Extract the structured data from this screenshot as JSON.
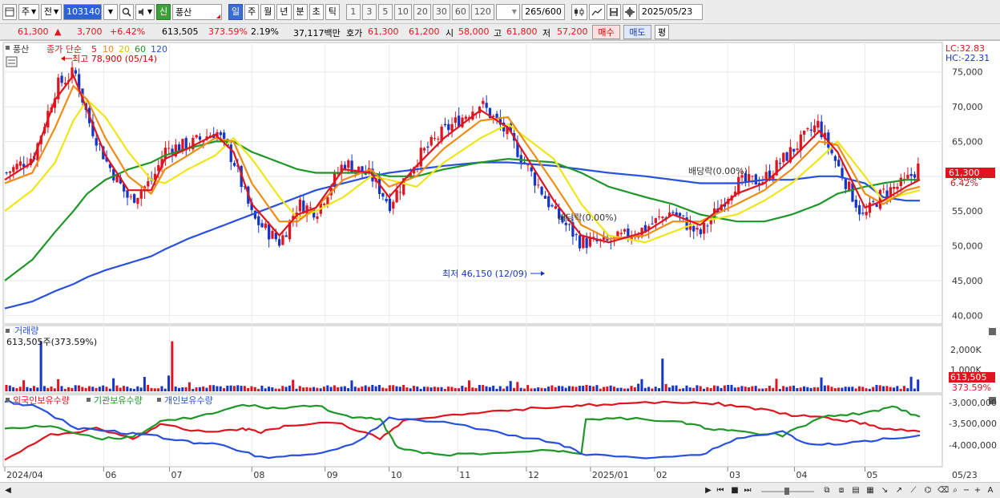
{
  "toolbar": {
    "mode": "주",
    "mode2": "전",
    "code": "103140",
    "stock_name": "풍산",
    "credit_badge": "신",
    "periods": [
      "일",
      "주",
      "월",
      "년",
      "분",
      "초",
      "틱"
    ],
    "active_period": "일",
    "intervals": [
      "1",
      "3",
      "5",
      "10",
      "20",
      "30",
      "60",
      "120"
    ],
    "count": "265",
    "count_total": "/600",
    "date": "2025/05/23"
  },
  "quote": {
    "price": "61,300",
    "arrow": "▲",
    "change": "3,700",
    "change_pct": "+6.42%",
    "volume": "613,505",
    "volume_ratio": "373.59%",
    "turnover_rate": "2.19%",
    "amount": "37,117백만",
    "ask_label": "호가",
    "ask1": "61,300",
    "ask2": "61,200",
    "open_label": "시",
    "open": "58,000",
    "high_label": "고",
    "high": "61,800",
    "low_label": "저",
    "low": "57,200",
    "buy_label": "매수",
    "sell_label": "매도",
    "avg_label": "평"
  },
  "legend": {
    "stock": "풍산",
    "ma_title": "종가 단순",
    "ma_periods": [
      "5",
      "10",
      "20",
      "60",
      "120"
    ],
    "ma_colors": [
      "#e0141e",
      "#f08c14",
      "#f0e614",
      "#1e9628",
      "#2850dc"
    ],
    "high_note": "최고 78,900 (05/14)",
    "low_note": "최저 46,150 (12/09)",
    "dividend1": "배당락(0.00%)",
    "dividend2": "배당락(0.00%)",
    "lc": "LC:32.83",
    "hc": "HC:-22.31"
  },
  "price_axis": {
    "labels": [
      "75,000",
      "70,000",
      "65,000",
      "60,000",
      "55,000",
      "50,000",
      "45,000",
      "40,000"
    ],
    "current": "61,300",
    "current_pct": "6.42%"
  },
  "volume_panel": {
    "title": "거래량",
    "value": "613,505주(373.59%)",
    "axis": [
      "2,000K",
      "1,000K"
    ],
    "current": "613,505",
    "current_pct": "373.59%"
  },
  "holdings_panel": {
    "series": [
      "외국인보유수량",
      "기관보유수량",
      "개인보유수량"
    ],
    "colors": [
      "#e0141e",
      "#1e9628",
      "#2850dc"
    ],
    "axis": [
      "-3,000,000",
      "-3,500,000",
      "-4,000,000"
    ]
  },
  "x_axis": {
    "labels": [
      "2024/04",
      "06",
      "07",
      "08",
      "09",
      "10",
      "11",
      "12",
      "2025/01",
      "02",
      "03",
      "04",
      "05"
    ],
    "right_label": "05/23"
  },
  "chart_data": {
    "type": "line",
    "price_ylim": [
      39000,
      79000
    ],
    "price_x": [
      0,
      0.03,
      0.055,
      0.075,
      0.09,
      0.11,
      0.135,
      0.16,
      0.175,
      0.2,
      0.23,
      0.25,
      0.27,
      0.3,
      0.32,
      0.34,
      0.37,
      0.4,
      0.42,
      0.45,
      0.48,
      0.52,
      0.55,
      0.6,
      0.63,
      0.66,
      0.7,
      0.73,
      0.76,
      0.8,
      0.83,
      0.86,
      0.89,
      0.91,
      0.94,
      0.96,
      0.985,
      1.0
    ],
    "close": [
      60500,
      63000,
      73000,
      75000,
      68000,
      62000,
      56500,
      59500,
      64000,
      64500,
      66500,
      62000,
      54000,
      50500,
      56000,
      55000,
      62000,
      60000,
      56000,
      62500,
      66500,
      70500,
      66000,
      55000,
      50500,
      50500,
      52500,
      55000,
      51500,
      59000,
      59500,
      63500,
      67500,
      62000,
      54000,
      57500,
      59000,
      61300
    ],
    "ma5": [
      59500,
      62000,
      71000,
      74500,
      69500,
      63000,
      58000,
      58000,
      62500,
      64000,
      66000,
      63500,
      56000,
      51500,
      54500,
      55500,
      61000,
      60500,
      57000,
      61500,
      65500,
      69500,
      67000,
      56500,
      51500,
      50500,
      52000,
      54500,
      53000,
      57500,
      59000,
      62500,
      66500,
      63500,
      55500,
      56500,
      58500,
      59500
    ],
    "ma10": [
      59000,
      60500,
      67000,
      73000,
      71000,
      65500,
      60000,
      57500,
      61000,
      63000,
      65500,
      65000,
      59000,
      53500,
      53500,
      55500,
      59500,
      61000,
      58500,
      60000,
      64000,
      68000,
      68500,
      59000,
      53000,
      51000,
      51500,
      53500,
      53500,
      56000,
      58000,
      61000,
      65000,
      64500,
      57500,
      56000,
      58000,
      58500
    ],
    "ma20": [
      55000,
      58000,
      62000,
      68000,
      71000,
      68500,
      63500,
      59500,
      59000,
      61000,
      63000,
      65500,
      62500,
      57000,
      54000,
      55000,
      57000,
      60000,
      59500,
      58500,
      62000,
      65500,
      67500,
      62500,
      56000,
      51500,
      50500,
      52000,
      53500,
      54500,
      56500,
      59000,
      62500,
      65000,
      60000,
      56500,
      57500,
      58000
    ],
    "ma60": [
      45000,
      48000,
      52000,
      55000,
      57500,
      59500,
      61000,
      62000,
      63000,
      64000,
      65000,
      65000,
      63500,
      62000,
      61000,
      60500,
      60500,
      60500,
      60000,
      60000,
      61000,
      62000,
      62500,
      62000,
      60500,
      58500,
      57000,
      56000,
      54500,
      53500,
      53500,
      54500,
      56000,
      57500,
      58500,
      59000,
      59500,
      59500
    ],
    "ma120": [
      41000,
      42000,
      43500,
      44500,
      45500,
      46500,
      47500,
      48500,
      49500,
      51000,
      52500,
      53500,
      54500,
      56000,
      57000,
      58000,
      59000,
      60000,
      60500,
      61000,
      61500,
      62000,
      62000,
      61500,
      61000,
      60500,
      60000,
      59500,
      59000,
      59000,
      59500,
      59500,
      60000,
      60000,
      59000,
      57000,
      56500,
      56500
    ]
  }
}
